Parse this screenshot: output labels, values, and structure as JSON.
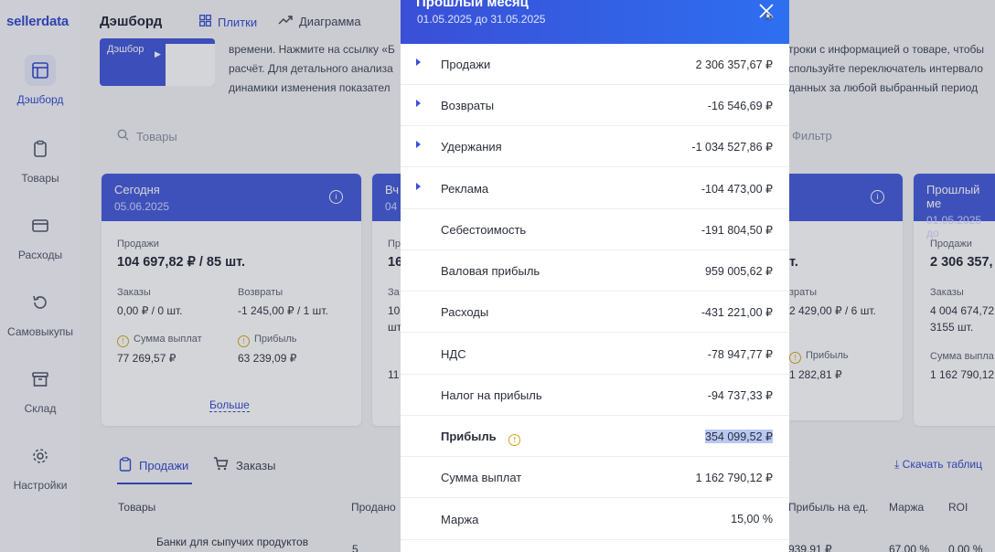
{
  "app": {
    "logo": "sellerdata"
  },
  "sidebar": {
    "items": [
      {
        "label": "Дэшборд",
        "icon": "dashboard-icon"
      },
      {
        "label": "Товары",
        "icon": "clipboard-icon"
      },
      {
        "label": "Расходы",
        "icon": "wallet-icon"
      },
      {
        "label": "Самовыкупы",
        "icon": "refresh-icon"
      },
      {
        "label": "Склад",
        "icon": "archive-icon"
      },
      {
        "label": "Настройки",
        "icon": "gear-icon"
      }
    ]
  },
  "header": {
    "title": "Дэшборд",
    "tabs": [
      "Плитки",
      "Диаграмма"
    ]
  },
  "intro": {
    "thumb_label": "Дэшбор",
    "lines": [
      "времени. Нажмите на ссылку «Б",
      "расчёт. Для детального анализа",
      "динамики изменения показател"
    ],
    "lines_right": [
      "троки с информацией о товаре, чтобы",
      "спользуйте переключатель интервало",
      "данных за любой выбранный период"
    ]
  },
  "search": {
    "placeholder": "Товары"
  },
  "filter": {
    "label": "Фильтр"
  },
  "card_today": {
    "title": "Сегодня",
    "date": "05.06.2025",
    "sales_label": "Продажи",
    "sales_value": "104 697,82 ₽ / 85 шт.",
    "orders_label": "Заказы",
    "orders_value": "0,00 ₽ / 0 шт.",
    "returns_label": "Возвраты",
    "returns_value": "-1 245,00 ₽ / 1 шт.",
    "payout_label": "Сумма выплат",
    "payout_value": "77 269,57 ₽",
    "profit_label": "Прибыль",
    "profit_value": "63 239,09 ₽",
    "more_label": "Больше"
  },
  "card_partial": {
    "title": "Вч",
    "date": "04",
    "sales_label": "Пр",
    "sales_value": "16",
    "orders_label": "За",
    "orders_value_1": "10",
    "orders_value_2": "шт",
    "payout_value": "11"
  },
  "card_right_partial": {
    "sales_value": "т.",
    "returns_label": "зраты",
    "returns_value": "2 429,00 ₽ / 6 шт.",
    "profit_label": "Прибыль",
    "profit_value": "1 282,81 ₽"
  },
  "card_last_month": {
    "title": "Прошлый ме",
    "date": "01.05.2025 до",
    "sales_label": "Продажи",
    "sales_value": "2 306 357,",
    "orders_label": "Заказы",
    "orders_value_1": "4 004 674,72",
    "orders_value_2": "3155 шт.",
    "payout_label": "Сумма выпла",
    "payout_value": "1 162 790,12"
  },
  "bottom": {
    "tabs": [
      "Продажи",
      "Заказы"
    ],
    "download": "Скачать таблиц",
    "columns": [
      "Товары",
      "Продано",
      "Прибыль на ед.",
      "Маржа",
      "ROI"
    ],
    "row_product": "Банки для сыпучих продуктов",
    "row_sold": "5",
    "row_profit_unit": "939,91 ₽",
    "row_margin": "67,00 %",
    "row_roi": "0,00 %"
  },
  "modal": {
    "title": "Прошлый месяц",
    "date_range": "01.05.2025 до 31.05.2025",
    "rows": [
      {
        "label": "Продажи",
        "value": "2 306 357,67 ₽",
        "expandable": true
      },
      {
        "label": "Возвраты",
        "value": "-16 546,69 ₽",
        "expandable": true
      },
      {
        "label": "Удержания",
        "value": "-1 034 527,86 ₽",
        "expandable": true
      },
      {
        "label": "Реклама",
        "value": "-104 473,00 ₽",
        "expandable": true
      },
      {
        "label": "Себестоимость",
        "value": "-191 804,50 ₽",
        "expandable": false
      },
      {
        "label": "Валовая прибыль",
        "value": "959 005,62 ₽",
        "expandable": false
      },
      {
        "label": "Расходы",
        "value": "-431 221,00 ₽",
        "expandable": false
      },
      {
        "label": "НДС",
        "value": "-78 947,77 ₽",
        "expandable": false
      },
      {
        "label": "Налог на прибыль",
        "value": "-94 737,33 ₽",
        "expandable": false
      },
      {
        "label": "Прибыль",
        "value": "354 099,52 ₽",
        "expandable": false
      },
      {
        "label": "Сумма выплат",
        "value": "1 162 790,12 ₽",
        "expandable": false
      },
      {
        "label": "Маржа",
        "value": "15,00 %",
        "expandable": false
      }
    ]
  },
  "colors": {
    "accent": "#3f56d8",
    "warning": "#d2a21a"
  }
}
